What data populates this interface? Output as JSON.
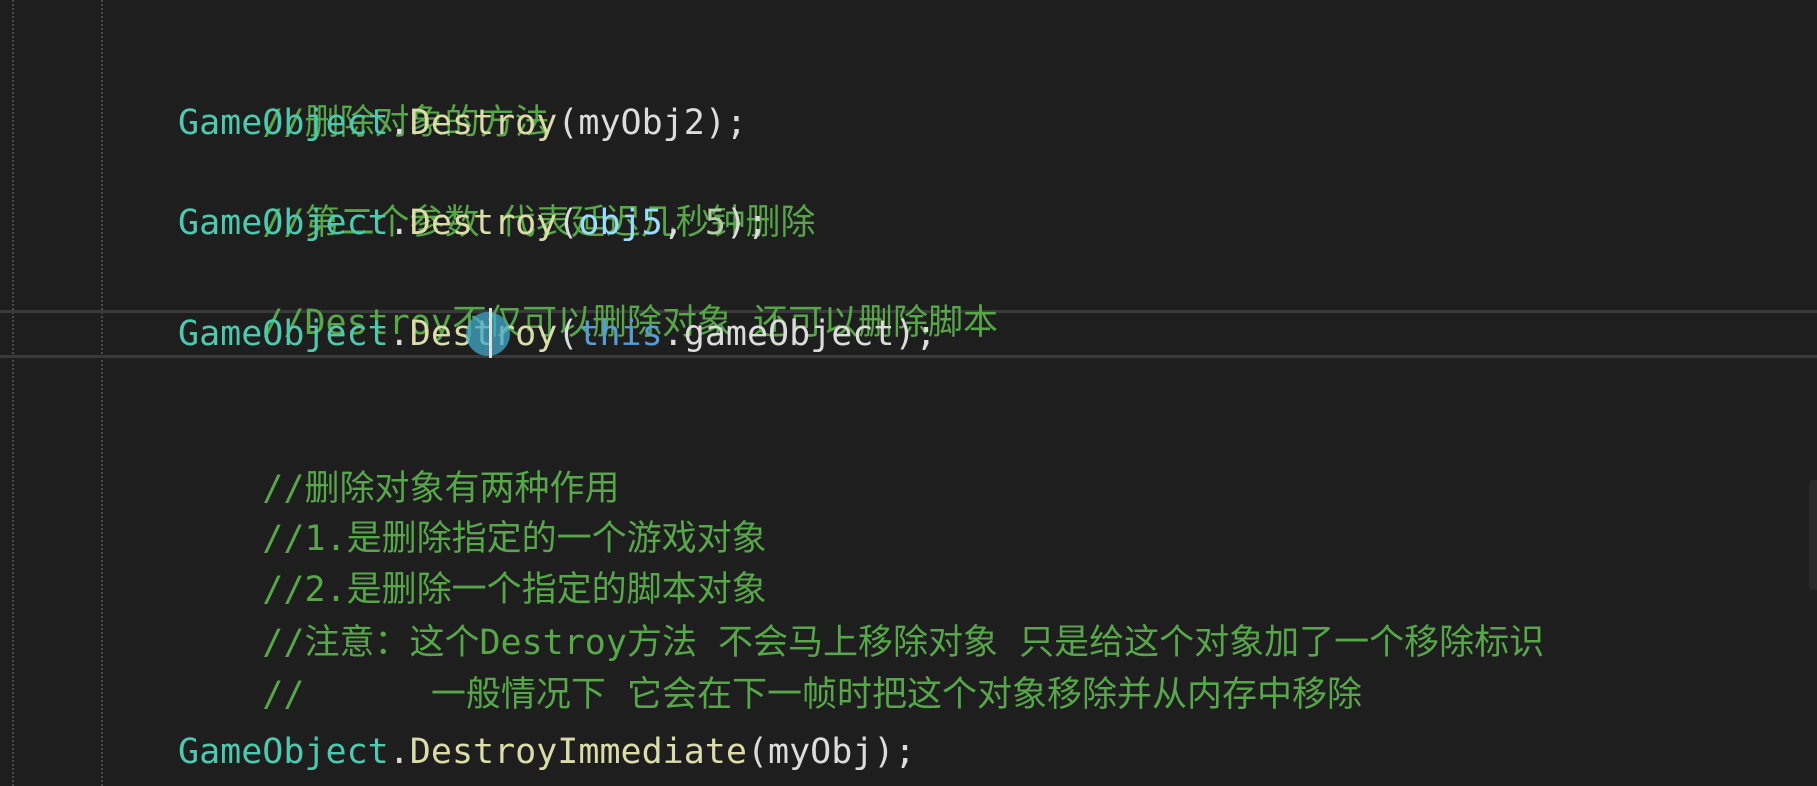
{
  "editor": {
    "lines": {
      "l1": {
        "comment": "//删除对象的方法"
      },
      "l2": {
        "cls": "GameObject",
        "dot": ".",
        "method": "Destroy",
        "open": "(",
        "arg": "myObj2",
        "close": ");"
      },
      "l3": {
        "comment": "//第二个参数 代表延迟几秒钟删除"
      },
      "l4": {
        "cls": "GameObject",
        "dot": ".",
        "method": "Destroy",
        "open": "(",
        "arg": "obj5",
        "sep": ", ",
        "num": "5",
        "close": ");"
      },
      "l5": {
        "comment": "//Destroy不仅可以删除对象 还可以删除脚本"
      },
      "l6": {
        "cls": "GameObject",
        "dot": ".",
        "method": "Destroy",
        "open": "(",
        "kw": "this",
        "dot2": ".",
        "member": "gameObject",
        "close": ");"
      },
      "l7": {
        "comment": "//删除对象有两种作用"
      },
      "l8": {
        "comment": "//1.是删除指定的一个游戏对象"
      },
      "l9": {
        "comment": "//2.是删除一个指定的脚本对象"
      },
      "l10": {
        "comment": "//注意：这个Destroy方法 不会马上移除对象 只是给这个对象加了一个移除标识"
      },
      "l11": {
        "comment": "//      一般情况下 它会在下一帧时把这个对象移除并从内存中移除"
      },
      "l12": {
        "cls": "GameObject",
        "dot": ".",
        "method": "DestroyImmediate",
        "open": "(",
        "arg": "myObj",
        "close": ");"
      }
    }
  }
}
